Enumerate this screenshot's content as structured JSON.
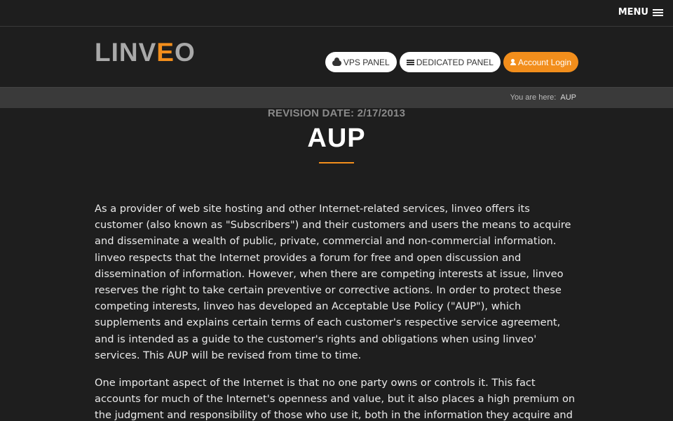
{
  "topbar": {
    "menu_label": "MENU"
  },
  "logo": {
    "text": "LINVEO"
  },
  "nav": {
    "vps_label": "VPS PANEL",
    "dedicated_label": "DEDICATED PANEL",
    "login_label": "Account Login"
  },
  "breadcrumb": {
    "prefix": "You are here:",
    "current": "AUP"
  },
  "page": {
    "revision": "REVISION DATE: 2/17/2013",
    "title": "AUP"
  },
  "content": {
    "paragraphs": [
      "As a provider of web site hosting and other Internet-related services, linveo offers its customer (also known as \"Subscribers\") and their customers and users the means to acquire and disseminate a wealth of public, private, commercial and non-commercial information. linveo respects that the Internet provides a forum for free and open discussion and dissemination of information. However, when there are competing interests at issue, linveo reserves the right to take certain preventive or corrective actions. In order to protect these competing interests, linveo has developed an Acceptable Use Policy (\"AUP\"), which supplements and explains certain terms of each customer's respective service agreement, and is intended as a guide to the customer's rights and obligations when using linveo' services. This AUP will be revised from time to time.",
      "One important aspect of the Internet is that no one party owns or controls it. This fact accounts for much of the Internet's openness and value, but it also places a high premium on the judgment and responsibility of those who use it, both in the information they acquire and in the"
    ]
  },
  "colors": {
    "accent": "#f28e1c",
    "background": "#1e1e1e",
    "breadcrumb_bar": "#3a3a3a"
  }
}
